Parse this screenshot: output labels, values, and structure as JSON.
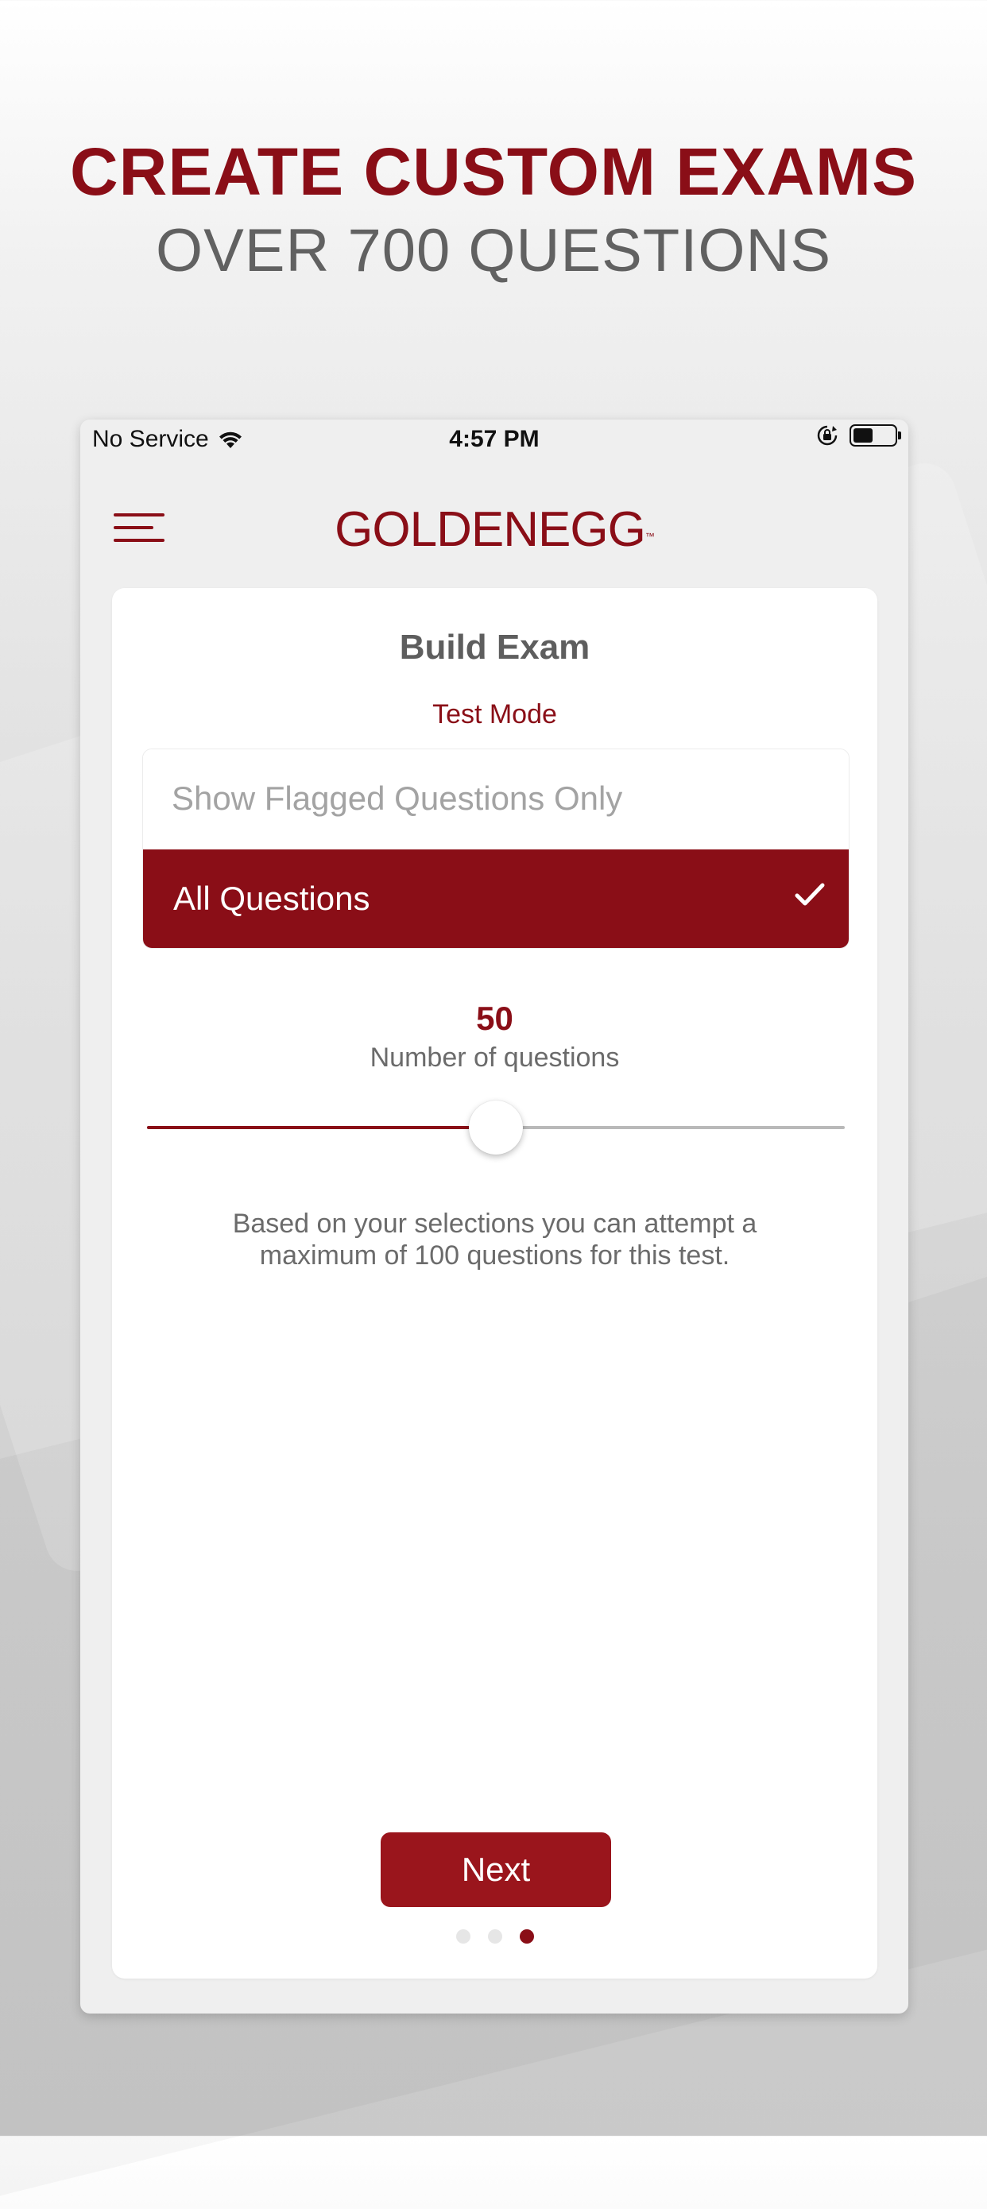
{
  "colors": {
    "brand_red": "#8a0e17",
    "button_red": "#9a151c",
    "headline_gray": "#616161",
    "slider_fill": "#8a0e17"
  },
  "headline": {
    "line1": "CREATE CUSTOM EXAMS",
    "line2": "OVER 700 QUESTIONS"
  },
  "status_bar": {
    "carrier": "No Service",
    "time": "4:57 PM",
    "icons": [
      "wifi-icon",
      "orientation-lock-icon",
      "battery-icon"
    ]
  },
  "header": {
    "menu_icon": "hamburger-menu-icon",
    "logo_bold": "GOLDEN",
    "logo_light": "EGG",
    "logo_tm": "™"
  },
  "build_exam": {
    "title": "Build Exam",
    "mode_label": "Test Mode",
    "options": [
      {
        "label": "Show Flagged Questions Only",
        "selected": false
      },
      {
        "label": "All Questions",
        "selected": true
      }
    ],
    "selected_icon": "checkmark-icon",
    "question_count": "50",
    "question_count_label": "Number of questions",
    "slider": {
      "min": 0,
      "max": 100,
      "value": 50
    },
    "info": "Based on your selections you can attempt a maximum of 100 questions for this test.",
    "next_label": "Next"
  },
  "pagination": {
    "total": 3,
    "current": 3
  }
}
